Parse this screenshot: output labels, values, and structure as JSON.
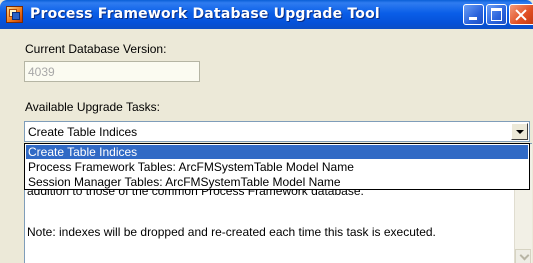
{
  "window": {
    "title": "Process Framework Database Upgrade Tool",
    "icons": {
      "app": "app-icon",
      "minimize": "minimize-icon",
      "maximize": "maximize-icon",
      "close": "close-icon"
    }
  },
  "version": {
    "label": "Current Database Version:",
    "value": "4039",
    "disabled": true
  },
  "tasks": {
    "label": "Available Upgrade Tasks:",
    "selected": "Create Table Indices",
    "options": [
      "Create Table Indices",
      "Process Framework Tables: ArcFMSystemTable Model Name",
      "Session Manager Tables: ArcFMSystemTable Model Name"
    ],
    "highlighted_index": 0
  },
  "description": {
    "lines": [
      "addition to those of the common Process Framework database.",
      "Note: indexes will be dropped and re-created each time this task is executed."
    ]
  },
  "colors": {
    "titlebar": "#0a5ee8",
    "selection": "#316ac5",
    "dialog_bg": "#ece9d8"
  }
}
